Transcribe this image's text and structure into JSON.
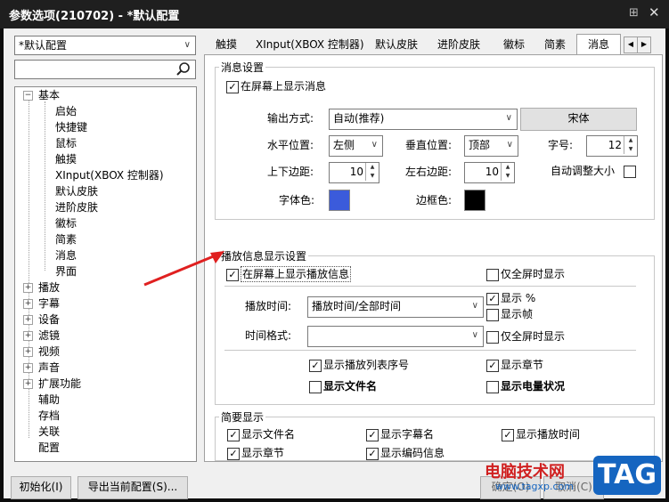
{
  "window": {
    "title": "参数选项(210702) - *默认配置"
  },
  "profile": {
    "selected": "*默认配置"
  },
  "tree": {
    "root": "基本",
    "children": [
      "启始",
      "快捷键",
      "鼠标",
      "触摸",
      "XInput(XBOX 控制器)",
      "默认皮肤",
      "进阶皮肤",
      "徽标",
      "简素",
      "消息",
      "界面"
    ],
    "collapsed": [
      "播放",
      "字幕",
      "设备",
      "滤镜",
      "视频",
      "声音",
      "扩展功能"
    ],
    "leaves": [
      "辅助",
      "存档",
      "关联",
      "配置"
    ]
  },
  "tabs": [
    "触摸",
    "XInput(XBOX 控制器)",
    "默认皮肤",
    "进阶皮肤",
    "徽标",
    "简素",
    "消息"
  ],
  "msg": {
    "group_title": "消息设置",
    "show_on_screen": "在屏幕上显示消息",
    "output_label": "输出方式:",
    "output_value": "自动(推荐)",
    "font_button": "宋体",
    "h_pos_label": "水平位置:",
    "h_pos_value": "左侧",
    "v_pos_label": "垂直位置:",
    "v_pos_value": "顶部",
    "font_size_label": "字号:",
    "font_size_value": "12",
    "tb_margin_label": "上下边距:",
    "tb_margin_value": "10",
    "lr_margin_label": "左右边距:",
    "lr_margin_value": "10",
    "auto_size": "自动调整大小",
    "font_color_label": "字体色:",
    "border_color_label": "边框色:",
    "font_color": "#3b5bdb",
    "border_color": "#000000"
  },
  "play": {
    "group_title": "播放信息显示设置",
    "show_play_info": "在屏幕上显示播放信息",
    "fullscreen_only": "仅全屏时显示",
    "time_label": "播放时间:",
    "time_value": "播放时间/全部时间",
    "show_pct": "显示 %",
    "show_frame": "显示帧",
    "format_label": "时间格式:",
    "fullscreen_only2": "仅全屏时显示",
    "show_playlist_no": "显示播放列表序号",
    "show_chapter": "显示章节",
    "show_filename": "显示文件名",
    "show_battery": "显示电量状况"
  },
  "brief": {
    "group_title": "简要显示",
    "items": [
      "显示文件名",
      "显示字幕名",
      "显示播放时间",
      "显示章节",
      "显示编码信息"
    ]
  },
  "bottom": {
    "init_button": "初始化(I)",
    "export_button": "导出当前配置(S)...",
    "ok_button": "确定(O)",
    "cancel_button": "取消(C)"
  },
  "watermark": {
    "site_name": "电脑技术网",
    "url": "www.tagxp.com",
    "badge": "TAG"
  },
  "colors": {
    "accent_arrow": "#e02020",
    "tag_badge": "#1565c0"
  }
}
